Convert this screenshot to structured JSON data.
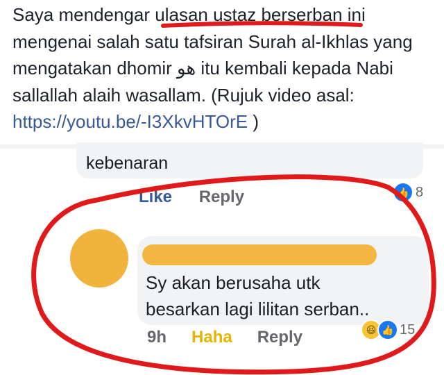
{
  "post": {
    "line1": "Saya mendengar ulasan ustaz berserban ini",
    "line2": "mengenai salah satu tafsiran Surah al-Ikhlas yang",
    "line3": "mengatakan dhomir هو itu kembali kepada Nabi",
    "line4": "sallallah alaih wasallam. (Rujuk video asal:",
    "link": "https://youtu.be/-I3XkvHTOrE",
    "closing": ")"
  },
  "comment1": {
    "text": "kebenaran",
    "like_label": "Like",
    "reply_label": "Reply",
    "reaction_count": "8"
  },
  "comment2": {
    "line1": "Sy akan berusaha utk",
    "line2": "besarkan lagi lilitan serban..",
    "time": "9h",
    "haha_label": "Haha",
    "reply_label": "Reply",
    "reaction_count": "15"
  },
  "colors": {
    "link": "#385898",
    "like_blue": "#1877f2",
    "annotation_red": "#e01a1a",
    "redaction_orange": "#f0b43c"
  },
  "icons": [
    "like-icon",
    "haha-icon",
    "redacted-avatar"
  ]
}
